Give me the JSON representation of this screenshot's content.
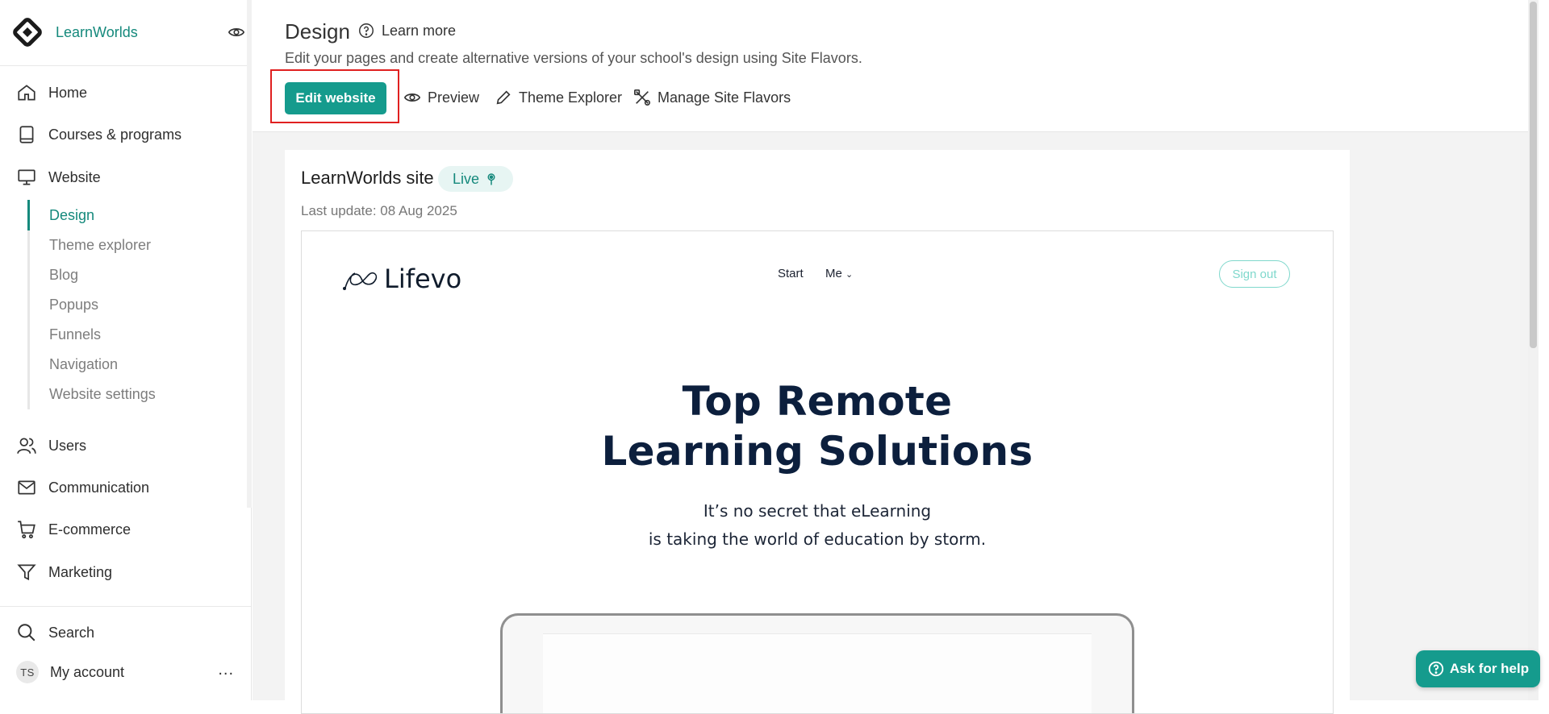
{
  "sidebar": {
    "brand": "LearnWorlds",
    "nav": [
      {
        "label": "Home",
        "icon": "home-icon"
      },
      {
        "label": "Courses & programs",
        "icon": "book-icon"
      },
      {
        "label": "Website",
        "icon": "monitor-icon"
      }
    ],
    "website_sub": [
      {
        "label": "Design",
        "active": true
      },
      {
        "label": "Theme explorer"
      },
      {
        "label": "Blog"
      },
      {
        "label": "Popups"
      },
      {
        "label": "Funnels"
      },
      {
        "label": "Navigation"
      },
      {
        "label": "Website settings"
      }
    ],
    "nav_bottom": [
      {
        "label": "Users",
        "icon": "users-icon"
      },
      {
        "label": "Communication",
        "icon": "mail-icon"
      },
      {
        "label": "E-commerce",
        "icon": "cart-icon"
      },
      {
        "label": "Marketing",
        "icon": "filter-icon"
      }
    ],
    "search": "Search",
    "account": {
      "initials": "TS",
      "label": "My account",
      "more": "..."
    }
  },
  "header": {
    "title": "Design",
    "learn_more": "Learn more",
    "subtitle": "Edit your pages and create alternative versions of your school's design using Site Flavors.",
    "edit_button": "Edit website",
    "tools": {
      "preview": "Preview",
      "theme_explorer": "Theme Explorer",
      "manage_flavors": "Manage Site Flavors"
    }
  },
  "site": {
    "name": "LearnWorlds site",
    "status": "Live",
    "last_update": "Last update: 08 Aug 2025",
    "preview": {
      "logo": "Lifevo",
      "nav": [
        "Start",
        "Me"
      ],
      "nav_dropdown_glyph": "⌄",
      "signout": "Sign out",
      "hero_line1": "Top Remote",
      "hero_line2": "Learning Solutions",
      "sub_line1": "It’s no secret that eLearning",
      "sub_line2": "is taking the world of education by storm."
    }
  },
  "help": {
    "label": "Ask for help"
  },
  "colors": {
    "accent": "#159b8d",
    "brand_text": "#15897c",
    "highlight": "#e02020",
    "hero_text": "#0c1f3d"
  }
}
